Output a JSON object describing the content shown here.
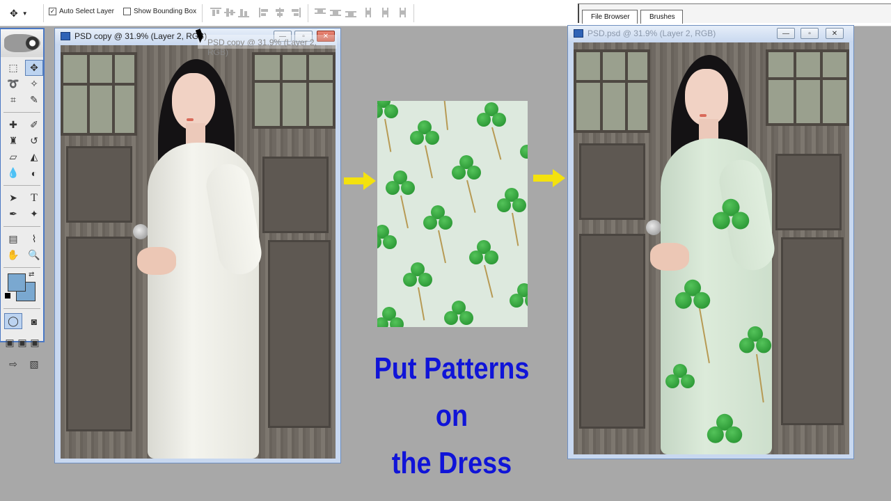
{
  "options_bar": {
    "auto_select_label": "Auto Select Layer",
    "auto_select_checked": true,
    "show_bbox_label": "Show Bounding Box",
    "show_bbox_checked": false
  },
  "palette_well": {
    "tabs": [
      {
        "label": "File Browser"
      },
      {
        "label": "Brushes"
      }
    ]
  },
  "toolbox": {
    "foreground_color": "#7aa8d0",
    "background_color": "#7aa8d0"
  },
  "left_doc": {
    "title": "PSD copy @ 31.9% (Layer 2, RGB)",
    "ghost_title": "PSD copy @ 31.9% (Layer 2, RGB)"
  },
  "right_doc": {
    "title": "PSD.psd @ 31.9% (Layer 2, RGB)"
  },
  "window_buttons": {
    "minimize": "—",
    "maximize": "▫",
    "close": "✕"
  },
  "caption": {
    "line1": "Put Patterns on",
    "line2": "the Dress"
  },
  "colors": {
    "caption": "#1014d8",
    "arrow": "#f4e20e",
    "clover": "#2a9a34"
  }
}
